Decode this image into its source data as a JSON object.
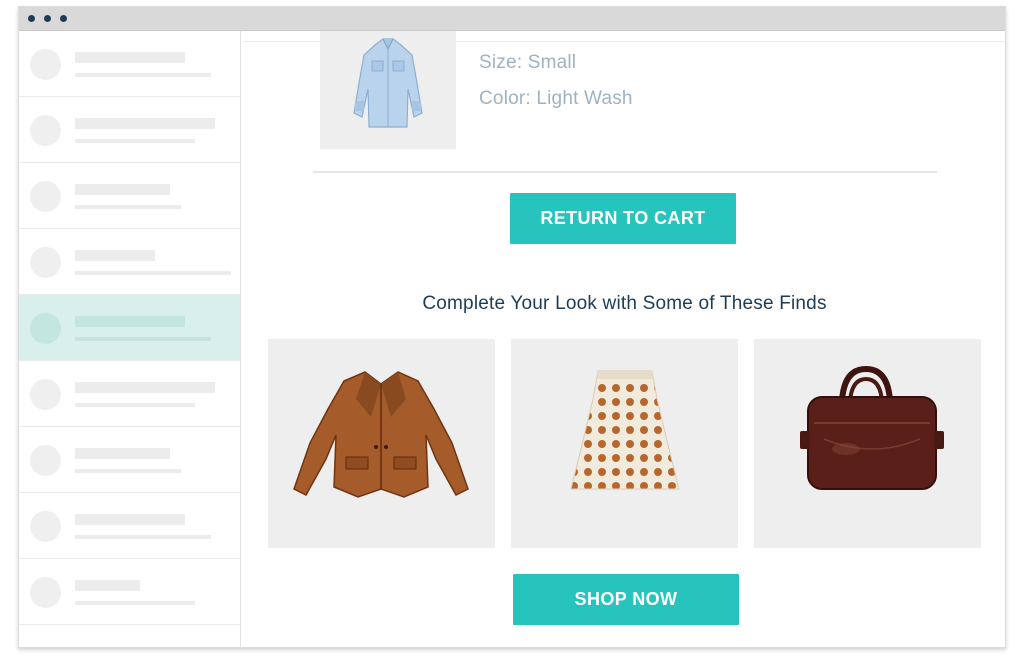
{
  "window": {
    "titlebar_dots": 3
  },
  "sidebar": {
    "items": [
      {
        "active": false
      },
      {
        "active": false
      },
      {
        "active": false
      },
      {
        "active": false
      },
      {
        "active": true
      },
      {
        "active": false
      },
      {
        "active": false
      },
      {
        "active": false
      },
      {
        "active": false
      }
    ]
  },
  "cart_item": {
    "image_icon": "denim-shirt-icon",
    "size_text": "Size: Small",
    "color_text": "Color: Light Wash"
  },
  "actions": {
    "return_label": "RETURN TO CART",
    "shop_label": "SHOP NOW"
  },
  "recommendations": {
    "title": "Complete Your Look with Some of These Finds",
    "items": [
      {
        "icon": "leather-jacket-icon"
      },
      {
        "icon": "polka-dot-skirt-icon"
      },
      {
        "icon": "leather-bag-icon"
      }
    ]
  },
  "colors": {
    "accent": "#27c4be",
    "heading": "#1c3d55",
    "meta_text": "#9fb2c2",
    "sidebar_active": "#d8efeb"
  }
}
